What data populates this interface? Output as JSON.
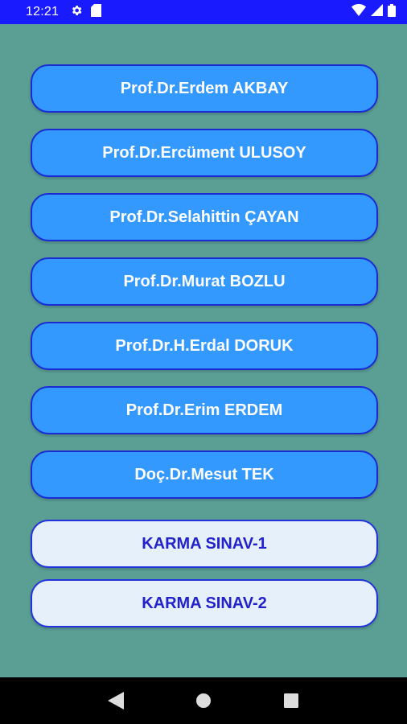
{
  "status_bar": {
    "time": "12:21",
    "icons": [
      "settings-gear-icon",
      "sd-card-icon",
      "wifi-icon",
      "signal-icon",
      "battery-icon"
    ]
  },
  "colors": {
    "status_bar": "#1a1aff",
    "background": "#5a9e94",
    "primary_button": "#3399ff",
    "secondary_button": "#e6f0fa",
    "button_border": "#1a2bd6"
  },
  "buttons": [
    {
      "label": "Prof.Dr.Erdem AKBAY"
    },
    {
      "label": "Prof.Dr.Ercüment ULUSOY"
    },
    {
      "label": "Prof.Dr.Selahittin ÇAYAN"
    },
    {
      "label": "Prof.Dr.Murat BOZLU"
    },
    {
      "label": "Prof.Dr.H.Erdal DORUK"
    },
    {
      "label": "Prof.Dr.Erim ERDEM"
    },
    {
      "label": "Doç.Dr.Mesut TEK"
    }
  ],
  "exam_buttons": [
    {
      "label": "KARMA SINAV-1"
    },
    {
      "label": "KARMA SINAV-2"
    }
  ],
  "nav_bar": {
    "icons": [
      "back-icon",
      "home-icon",
      "recents-icon"
    ]
  }
}
